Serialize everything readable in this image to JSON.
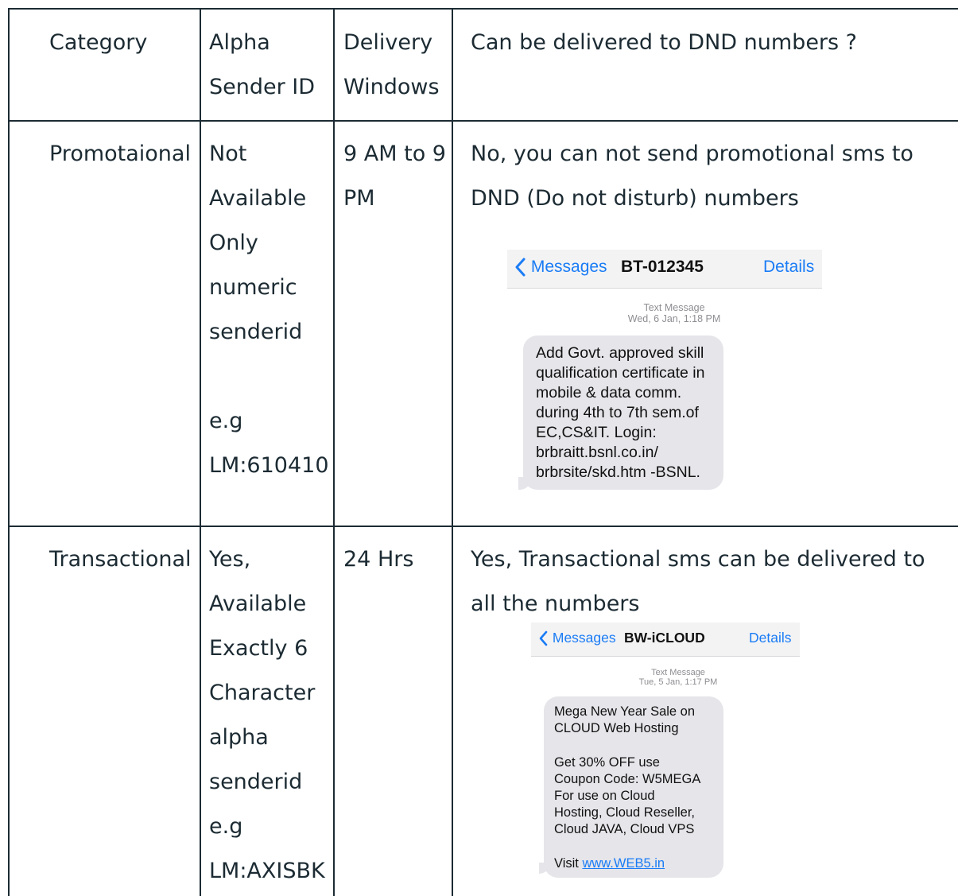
{
  "table": {
    "headers": {
      "category": "Category",
      "alpha_line1": "Alpha",
      "alpha_line2": "Sender ID",
      "delivery_line1": "Delivery",
      "delivery_line2": "Windows",
      "dnd": "Can be delivered to DND numbers ?"
    },
    "rows": [
      {
        "category": "Promotaional",
        "alpha_lines": [
          "Not",
          "Available",
          "Only",
          "numeric",
          "senderid",
          "",
          "e.g",
          "LM:610410"
        ],
        "delivery_lines": [
          "9 AM to 9",
          "PM"
        ],
        "dnd_lines": [
          "No, you can not send promotional sms to",
          "DND (Do not disturb) numbers"
        ],
        "screenshot": {
          "back_label": "Messages",
          "sender": "BT-012345",
          "details_label": "Details",
          "meta_type": "Text Message",
          "meta_time": "Wed, 6 Jan, 1:18 PM",
          "message_lines": [
            "Add Govt. approved skill",
            "qualification certificate in",
            "mobile & data comm.",
            "during 4th to 7th sem.of",
            "EC,CS&IT. Login:",
            "brbraitt.bsnl.co.in/",
            "brbrsite/skd.htm -BSNL."
          ]
        }
      },
      {
        "category": "Transactional",
        "alpha_lines": [
          "Yes,",
          "Available",
          "Exactly 6",
          "Character",
          "alpha",
          "senderid",
          "e.g",
          "LM:AXISBK"
        ],
        "delivery_lines": [
          "24 Hrs"
        ],
        "dnd_lines": [
          "Yes, Transactional sms can be delivered to",
          "all the numbers"
        ],
        "screenshot": {
          "back_label": "Messages",
          "sender": "BW-iCLOUD",
          "details_label": "Details",
          "meta_type": "Text Message",
          "meta_time": "Tue, 5 Jan, 1:17 PM",
          "message_lines": [
            "Mega New Year Sale on",
            "CLOUD Web Hosting",
            "",
            "Get 30% OFF use",
            "Coupon Code: W5MEGA",
            "For use on Cloud",
            "Hosting, Cloud Reseller,",
            "Cloud JAVA, Cloud VPS",
            ""
          ],
          "visit_label": "Visit",
          "visit_link": "www.WEB5.in"
        }
      }
    ]
  },
  "colors": {
    "text": "#1c2b33",
    "grid": "#1c2b33",
    "ios_blue": "#1a7cf5",
    "bubble": "#e5e5ea"
  },
  "icons": {
    "back": "chevron-left-icon"
  }
}
